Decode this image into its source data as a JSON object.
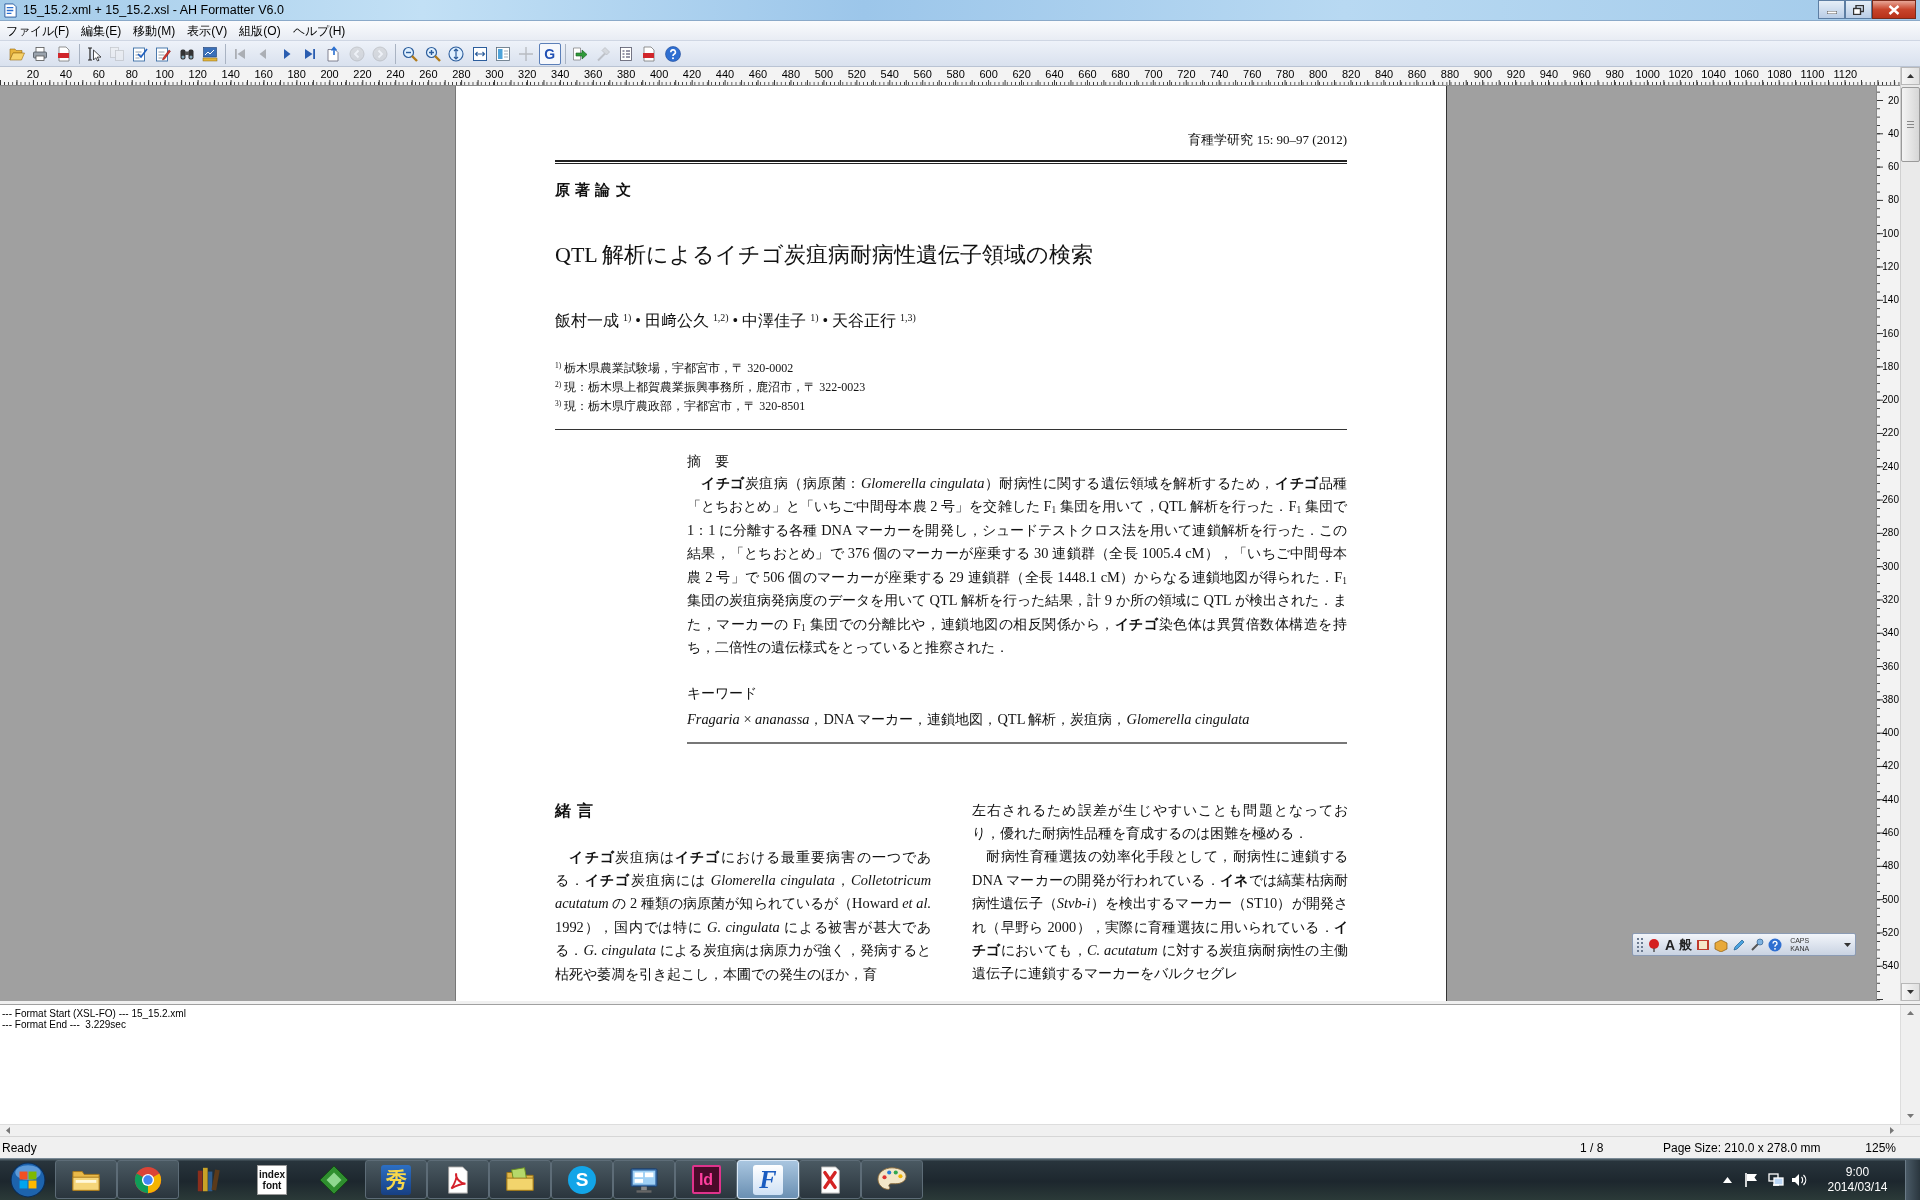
{
  "window": {
    "title": "15_15.2.xml + 15_15.2.xsl - AH Formatter V6.0"
  },
  "menu": [
    "ファイル(F)",
    "編集(E)",
    "移動(M)",
    "表示(V)",
    "組版(O)",
    "ヘルプ(H)"
  ],
  "toolbar": {
    "groups": [
      [
        {
          "disabled": false,
          "on": false
        },
        {
          "disabled": false,
          "on": false
        },
        {
          "disabled": false,
          "on": false
        }
      ],
      [
        {
          "disabled": false,
          "on": false
        },
        {
          "disabled": true,
          "on": false
        },
        {
          "disabled": false,
          "on": false
        },
        {
          "disabled": false,
          "on": false
        },
        {
          "disabled": false,
          "on": false
        },
        {
          "disabled": false,
          "on": false
        }
      ],
      [
        {
          "disabled": true,
          "on": false
        },
        {
          "disabled": true,
          "on": false
        },
        {
          "disabled": false,
          "on": false
        },
        {
          "disabled": false,
          "on": false
        },
        {
          "disabled": false,
          "on": false
        },
        {
          "disabled": true,
          "on": false
        },
        {
          "disabled": true,
          "on": false
        }
      ],
      [
        {
          "disabled": false,
          "on": false
        },
        {
          "disabled": false,
          "on": false
        },
        {
          "disabled": false,
          "on": false
        },
        {
          "disabled": false,
          "on": false
        },
        {
          "disabled": false,
          "on": false
        },
        {
          "disabled": true,
          "on": false
        },
        {
          "label": "G",
          "disabled": false,
          "on": true
        }
      ],
      [
        {
          "disabled": false,
          "on": false
        },
        {
          "disabled": true,
          "on": false
        },
        {
          "disabled": false,
          "on": false
        },
        {
          "disabled": false,
          "on": false
        },
        {
          "disabled": false,
          "on": false
        }
      ]
    ]
  },
  "horizontal_ruler": {
    "labels": [
      "20",
      "40",
      "60",
      "80",
      "100",
      "120",
      "140",
      "160",
      "180",
      "200",
      "220",
      "240",
      "260",
      "280",
      "300",
      "320",
      "340",
      "360",
      "380",
      "400",
      "420",
      "440",
      "460",
      "480",
      "500",
      "520",
      "540",
      "560",
      "580",
      "600",
      "620",
      "640",
      "660",
      "680",
      "700",
      "720",
      "740",
      "760",
      "780",
      "800",
      "820",
      "840",
      "860",
      "880",
      "900",
      "920",
      "940",
      "960",
      "980",
      "1000",
      "1020",
      "1040",
      "1060",
      "1080",
      "1100",
      "1120"
    ]
  },
  "vertical_ruler": {
    "labels": [
      "20",
      "40",
      "60",
      "80",
      "100",
      "120",
      "140",
      "160",
      "180",
      "200",
      "220",
      "240",
      "260",
      "280",
      "300",
      "320",
      "340",
      "360",
      "380",
      "400",
      "420",
      "440",
      "460",
      "480",
      "500",
      "520",
      "540"
    ]
  },
  "document": {
    "journal_reference": "育種学研究 15: 90–97 (2012)",
    "article_type": "原 著 論 文",
    "title": "QTL 解析によるイチゴ炭疽病耐病性遺伝子領域の検索",
    "authors": "飯村一成 $^{1)}$ • 田﨑公久 $^{1,2)}$ • 中澤佳子 $^{1)}$ • 天谷正行 $^{1,3)}$",
    "affiliations": [
      "$^{1)}$ 栃木県農業試験場，宇都宮市，〒 320-0002",
      "$^{2)}$ 現：栃木県上都賀農業振興事務所，鹿沼市，〒 322-0023",
      "$^{3)}$ 現：栃木県庁農政部，宇都宮市，〒 320-8501"
    ],
    "abstract": {
      "heading": "摘　要",
      "text": "**イチゴ**炭疽病（病原菌：*Glomerella cingulata*）耐病性に関する遺伝領域を解析するため，**イチゴ**品種「とちおとめ」と「いちご中間母本農 2 号」を交雑した F$_{1}$ 集団を用いて，QTL 解析を行った．F$_{1}$ 集団で 1：1 に分離する各種 DNA マーカーを開発し，シュードテストクロス法を用いて連鎖解析を行った．この結果，「とちおとめ」で 376 個のマーカーが座乗する 30 連鎖群（全長 1005.4 cM），「いちご中間母本農 2 号」で 506 個のマーカーが座乗する 29 連鎖群（全長 1448.1 cM）からなる連鎖地図が得られた．F$_{1}$ 集団の炭疽病発病度のデータを用いて QTL 解析を行った結果，計 9 か所の領域に QTL が検出された．また，マーカーの F$_{1}$ 集団での分離比や，連鎖地図の相反関係から，**イチゴ**染色体は異質倍数体構造を持ち，二倍性の遺伝様式をとっていると推察された．",
      "keywords_heading": "キーワード",
      "keywords": "*Fragaria* × *ananassa*，DNA マーカー，連鎖地図，QTL 解析，炭疽病，*Glomerella cingulata*"
    },
    "section": {
      "heading": "緒 言",
      "column_1": [
        {
          "text": "**イチゴ**炭疽病は**イチゴ**における最重要病害の一つである．**イチゴ**炭疽病には *Glomerella cingulata*，*Colletotricum acutatum* の 2 種類の病原菌が知られているが（Howard *et al.* 1992），国内では特に *G. cingulata* による被害が甚大である．*G. cingulata* による炭疽病は病原力が強く，発病すると枯死や萎凋を引き起こし，本圃での発生のほか，育",
          "indent": true
        }
      ],
      "column_2": [
        {
          "text": "左右されるため誤差が生じやすいことも問題となっており，優れた耐病性品種を育成するのは困難を極める．",
          "indent": false
        },
        {
          "text": "耐病性育種選抜の効率化手段として，耐病性に連鎖する DNA マーカーの開発が行われている．**イネ**では縞葉枯病耐病性遺伝子（*Stvb-i*）を検出するマーカー（ST10）が開発され（早野ら 2000），実際に育種選抜に用いられている．**イチゴ**においても，*C. acutatum* に対する炭疽病耐病性の主働遺伝子に連鎖するマーカーをバルクセグレ",
          "indent": true
        }
      ]
    }
  },
  "language_bar": {
    "input_mode": "A",
    "conversion_mode": "般",
    "caps": "CAPS",
    "kana": "KANA"
  },
  "log": [
    "--- Format Start (XSL-FO) --- 15_15.2.xml",
    "--- Format End ---  3.229sec"
  ],
  "status_bar": {
    "message": "Ready",
    "page": "1 / 8",
    "page_size": "Page Size: 210.0 x 278.0 mm",
    "zoom": "125%"
  },
  "taskbar": {
    "apps": [
      {
        "running": true,
        "active": false
      },
      {
        "running": true,
        "active": false
      },
      {
        "running": false,
        "active": false
      },
      {
        "running": false,
        "active": false,
        "logo_text": "index font"
      },
      {
        "running": false,
        "active": false
      },
      {
        "running": true,
        "active": false,
        "logo_text": "秀"
      },
      {
        "running": true,
        "active": false
      },
      {
        "running": true,
        "active": false
      },
      {
        "running": true,
        "active": false,
        "logo_text": "S"
      },
      {
        "running": true,
        "active": false
      },
      {
        "running": true,
        "active": false,
        "logo_text": "Id"
      },
      {
        "running": true,
        "active": true,
        "logo_text": "F"
      },
      {
        "running": true,
        "active": false
      },
      {
        "running": true,
        "active": false
      }
    ],
    "clock": {
      "time": "9:00",
      "date": "2014/03/14"
    }
  }
}
